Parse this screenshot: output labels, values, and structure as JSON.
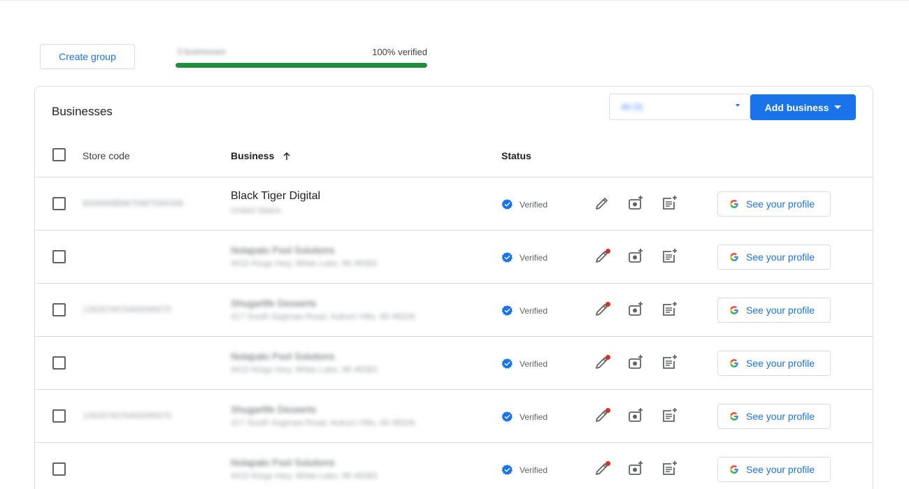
{
  "toolbar": {
    "create_group_label": "Create group",
    "progress_count": "3 businesses",
    "progress_label": "100% verified",
    "progress_fraction": 1.0
  },
  "panel": {
    "title": "Businesses",
    "filter_value": "All (3)",
    "add_business_label": "Add business"
  },
  "table": {
    "columns": {
      "store_code": "Store code",
      "business": "Business",
      "status": "Status"
    },
    "action_button_label": "See your profile",
    "rows": [
      {
        "store_code": "8006868B8875987D8A305",
        "name": "Black Tiger Digital",
        "name_blurred": false,
        "address": "United States",
        "status": "Verified",
        "edit_alert": false
      },
      {
        "store_code": "",
        "name": "Nolapalo Pool Solutions",
        "name_blurred": true,
        "address": "4415 Kings Hwy, White Lake, MI 48383",
        "status": "Verified",
        "edit_alert": true
      },
      {
        "store_code": "1262574076400095070",
        "name": "Shugarlife Desserts",
        "name_blurred": true,
        "address": "417 South Saginaw Road, Auburn Hills, MI 48326",
        "status": "Verified",
        "edit_alert": true
      },
      {
        "store_code": "",
        "name": "Nolapalo Pool Solutions",
        "name_blurred": true,
        "address": "4415 Kings Hwy, White Lake, MI 48383",
        "status": "Verified",
        "edit_alert": true
      },
      {
        "store_code": "1262574076400095070",
        "name": "Shugarlife Desserts",
        "name_blurred": true,
        "address": "417 South Saginaw Road, Auburn Hills, MI 48326",
        "status": "Verified",
        "edit_alert": true
      },
      {
        "store_code": "",
        "name": "Nolapalo Pool Solutions",
        "name_blurred": true,
        "address": "4415 Kings Hwy, White Lake, MI 48383",
        "status": "Verified",
        "edit_alert": true
      }
    ]
  },
  "icons": {
    "verified": "verified-badge-icon",
    "edit": "pencil-icon",
    "photo": "add-photo-icon",
    "post": "add-post-icon",
    "google": "google-g-icon",
    "sort": "arrow-up-icon"
  },
  "colors": {
    "accent": "#1a73e8",
    "progress": "#1e8e3e",
    "alert": "#d93025"
  }
}
